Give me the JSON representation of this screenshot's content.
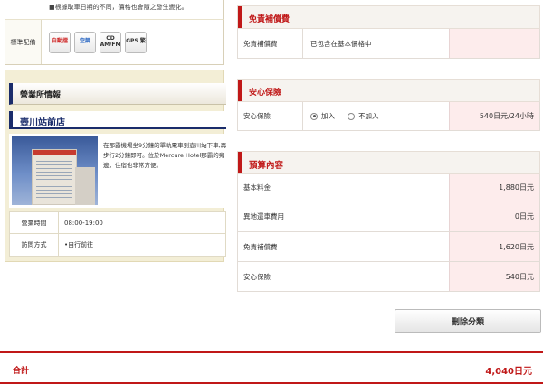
{
  "left": {
    "notice": "■根據取車日期的不同，價格也會隨之發生變化。",
    "equipment_label": "標準配備",
    "equipment": [
      {
        "icon": "automatic-icon",
        "label": "自動擋"
      },
      {
        "icon": "aircon-icon",
        "label": "空調"
      },
      {
        "icon": "cd-radio-icon",
        "label": "CD AM/FM"
      },
      {
        "icon": "gps-icon",
        "label": "GPS 繁"
      }
    ],
    "office_title": "營業所情報",
    "store_name": "壺川站前店",
    "store_description": "在那霸機場坐9分鐘的單軌電車到壺川站下車,再步行2分鐘即可。位於Mercure Hotel那霸的旁邊，住宿也非常方便。",
    "info": [
      {
        "key": "營業時間",
        "value": "08:00-19:00"
      },
      {
        "key": "訪問方式",
        "value": "•自行前往"
      }
    ]
  },
  "cdw": {
    "title": "免責補償費",
    "label": "免責補償費",
    "note": "已包含在基本價格中",
    "value": ""
  },
  "insurance": {
    "title": "安心保險",
    "label": "安心保險",
    "options": [
      {
        "label": "加入",
        "selected": true
      },
      {
        "label": "不加入",
        "selected": false
      }
    ],
    "value": "540日元/24小時"
  },
  "estimate": {
    "title": "預算內容",
    "rows": [
      {
        "label": "基本料金",
        "value": "1,880日元"
      },
      {
        "label": "異地還車費用",
        "value": "0日元"
      },
      {
        "label": "免責補償費",
        "value": "1,620日元"
      },
      {
        "label": "安心保險",
        "value": "540日元"
      }
    ]
  },
  "remove_button": "刪除分類",
  "total": {
    "label": "合計",
    "value": "4,040日元"
  },
  "colors": {
    "accent_red": "#c01818",
    "navy": "#1a2c6b",
    "value_bg": "#fdecec",
    "panel_bg": "#f3eed6"
  }
}
